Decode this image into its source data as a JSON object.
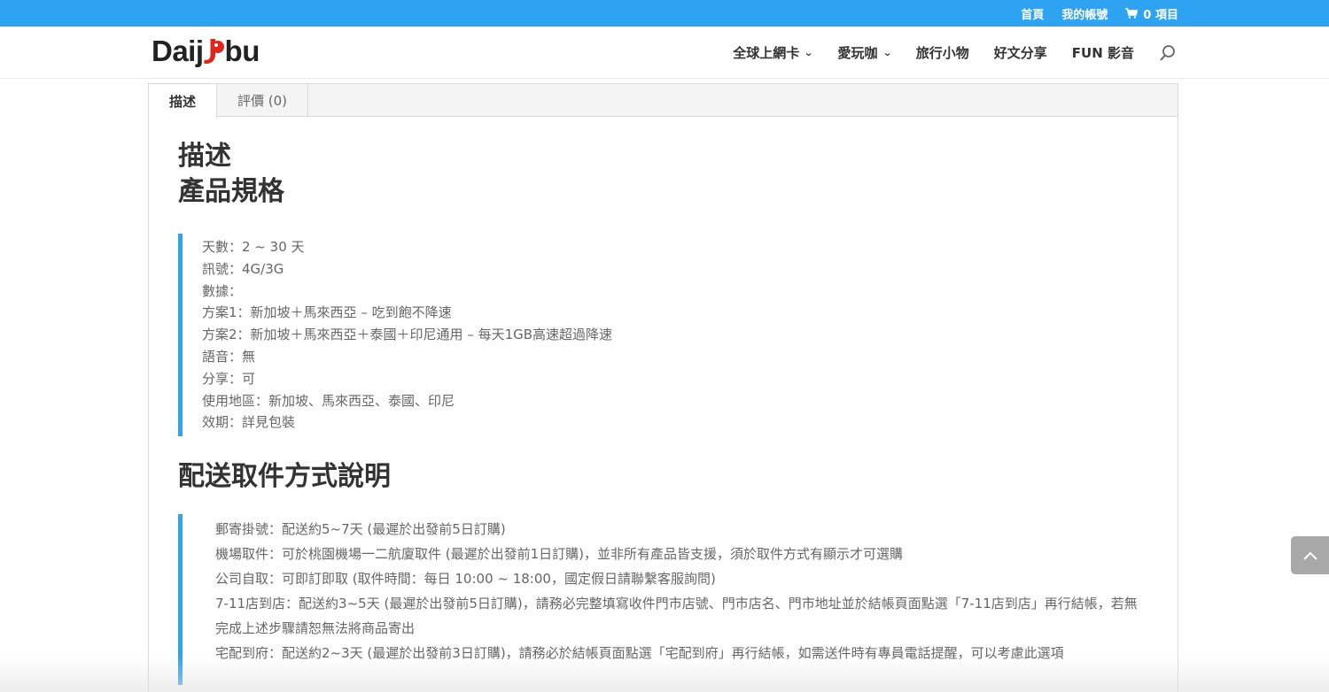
{
  "topbar": {
    "home": "首頁",
    "account": "我的帳號",
    "cart_label": "0 項目"
  },
  "logo": {
    "left": "Daij",
    "mid": "J",
    "right": "bu"
  },
  "nav": {
    "items": [
      {
        "label": "全球上網卡",
        "has_dropdown": true
      },
      {
        "label": "愛玩咖",
        "has_dropdown": true
      },
      {
        "label": "旅行小物",
        "has_dropdown": false
      },
      {
        "label": "好文分享",
        "has_dropdown": false
      },
      {
        "label": "FUN 影音",
        "has_dropdown": false
      }
    ],
    "chevron": "⌄"
  },
  "tabs": [
    {
      "label": "描述",
      "active": true
    },
    {
      "label": "評價 (0)",
      "active": false
    }
  ],
  "content": {
    "heading1": "描述",
    "heading2": "產品規格",
    "specs": [
      "天數：2 ~ 30 天",
      "訊號：4G/3G",
      "數據：",
      "方案1：新加坡＋馬來西亞 – 吃到飽不降速",
      "方案2：新加坡＋馬來西亞＋泰國＋印尼通用 – 每天1GB高速超過降速",
      "語音：無",
      "分享：可",
      "使用地區：新加坡、馬來西亞、泰國、印尼",
      "效期：詳見包裝"
    ],
    "heading3": "配送取件方式說明",
    "delivery": [
      "郵寄掛號：配送約5~7天 (最遲於出發前5日訂購)",
      "機場取件：可於桃園機場一二航廈取件 (最遲於出發前1日訂購)，並非所有產品皆支援，須於取件方式有顯示才可選購",
      "公司自取：可即訂即取 (取件時間：每日 10:00 ~ 18:00，國定假日請聯繫客服詢問)",
      "7-11店到店：配送約3~5天 (最遲於出發前5日訂購)，請務必完整填寫收件門市店號、門市店名、門市地址並於結帳頁面點選「7-11店到店」再行結帳，若無完成上述步驟請恕無法將商品寄出",
      "宅配到府：配送約2~3天 (最遲於出發前3日訂購)，請務必於結帳頁面點選「宅配到府」再行結帳，如需送件時有專員電話提醒，可以考慮此選項"
    ]
  },
  "colors": {
    "accent": "#2ea3f2",
    "brand_red": "#e1251b"
  }
}
